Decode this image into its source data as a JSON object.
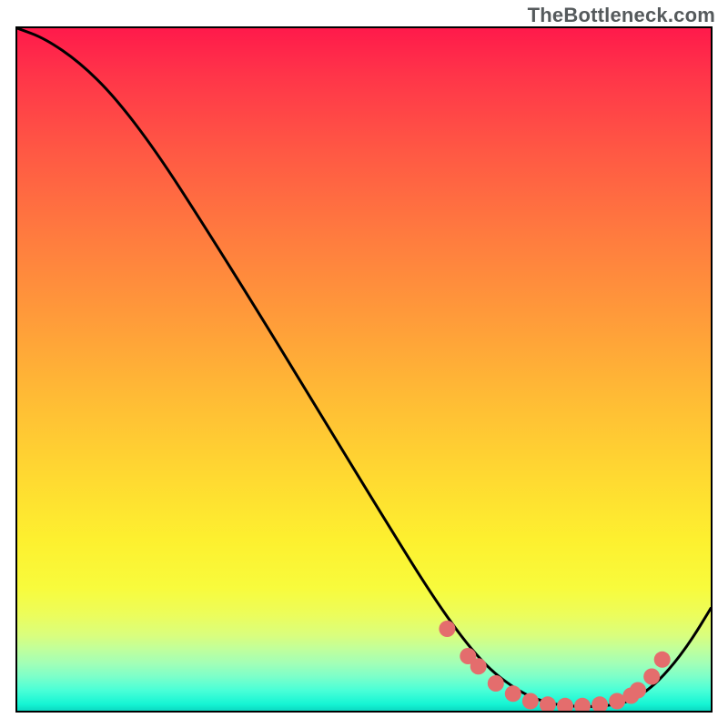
{
  "watermark": "TheBottleneck.com",
  "chart_data": {
    "type": "line",
    "title": "",
    "xlabel": "",
    "ylabel": "",
    "xlim": [
      0,
      100
    ],
    "ylim": [
      0,
      100
    ],
    "grid": false,
    "legend": false,
    "series": [
      {
        "name": "curve",
        "x": [
          0,
          4,
          9,
          14,
          20,
          27,
          35,
          44,
          53,
          61,
          67,
          72,
          76,
          80,
          84,
          88,
          91,
          94,
          97,
          100
        ],
        "y": [
          100,
          98.5,
          95,
          90,
          82,
          71,
          58,
          43,
          28,
          15,
          7,
          3,
          1.2,
          0.6,
          0.6,
          1.2,
          3,
          6,
          10,
          15
        ]
      }
    ],
    "points": {
      "name": "highlight-dots",
      "x": [
        62,
        65,
        66.5,
        69,
        71.5,
        74,
        76.5,
        79,
        81.5,
        84,
        86.5,
        88.5,
        89.5,
        91.5,
        93
      ],
      "y": [
        12,
        8,
        6.5,
        4,
        2.5,
        1.4,
        0.9,
        0.7,
        0.7,
        0.9,
        1.4,
        2.2,
        3,
        5,
        7.5
      ]
    },
    "colors": {
      "curve": "#000000",
      "dots": "#e46d6d",
      "gradient_top": "#ff1a4b",
      "gradient_mid": "#ffda31",
      "gradient_bottom": "#0cd9c2"
    }
  }
}
